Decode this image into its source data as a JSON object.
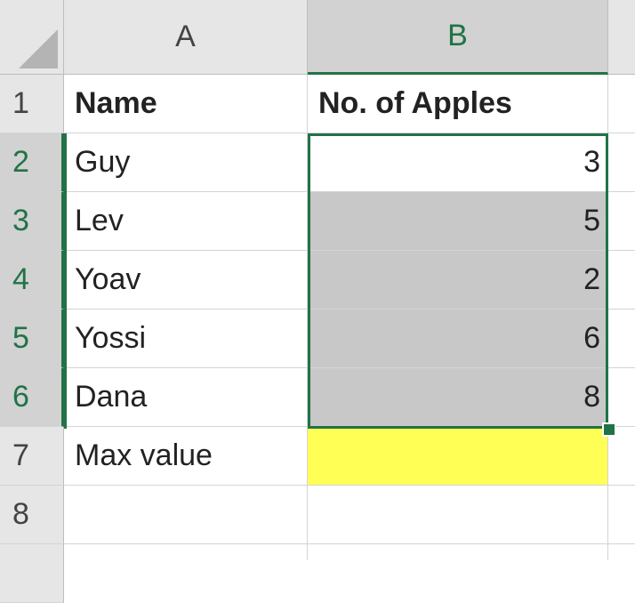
{
  "columns": [
    "A",
    "B"
  ],
  "rows": [
    "1",
    "2",
    "3",
    "4",
    "5",
    "6",
    "7",
    "8"
  ],
  "cells": {
    "A1": "Name",
    "B1": "No. of Apples",
    "A2": "Guy",
    "B2": "3",
    "A3": "Lev",
    "B3": "5",
    "A4": "Yoav",
    "B4": "2",
    "A5": "Yossi",
    "B5": "6",
    "A6": "Dana",
    "B6": "8",
    "A7": "Max value",
    "B7": "",
    "A8": "",
    "B8": ""
  },
  "colors": {
    "selection": "#217346",
    "highlight_yellow": "#ffff55",
    "shaded_range": "#c8c8c8"
  }
}
